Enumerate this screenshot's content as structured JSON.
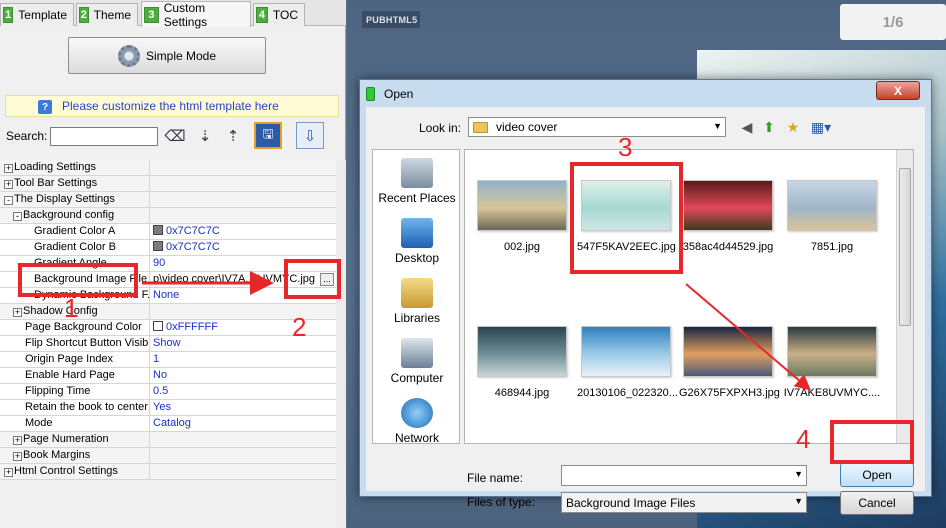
{
  "tabs": [
    {
      "num": "1",
      "label": "Template"
    },
    {
      "num": "2",
      "label": "Theme"
    },
    {
      "num": "3",
      "label": "Custom Settings"
    },
    {
      "num": "4",
      "label": "TOC"
    }
  ],
  "simple_mode_label": "Simple Mode",
  "info_text": "Please customize the html template here",
  "search_label": "Search:",
  "properties": [
    {
      "key": "Loading Settings",
      "value": "",
      "expander": "+",
      "indent": 0
    },
    {
      "key": "Tool Bar Settings",
      "value": "",
      "expander": "+",
      "indent": 0
    },
    {
      "key": "The Display Settings",
      "value": "",
      "expander": "-",
      "indent": 0
    },
    {
      "key": "Background config",
      "value": "",
      "expander": "-",
      "indent": 1
    },
    {
      "key": "Gradient Color A",
      "value": "0x7C7C7C",
      "swatch": "#7c7c7c",
      "indent": 2
    },
    {
      "key": "Gradient Color B",
      "value": "0x7C7C7C",
      "swatch": "#7c7c7c",
      "indent": 2
    },
    {
      "key": "Gradient Angle",
      "value": "90",
      "indent": 2
    },
    {
      "key": "Background Image File",
      "value": "p\\video cover\\IV7A..8UVMYC.jpg",
      "ellipsis": "...",
      "indent": 2
    },
    {
      "key": "Dynamic Background F...",
      "value": "None",
      "indent": 2
    },
    {
      "key": "Shadow Config",
      "value": "",
      "expander": "+",
      "indent": 1
    },
    {
      "key": "Page Background Color",
      "value": "0xFFFFFF",
      "swatch": "#ffffff",
      "indent": 1
    },
    {
      "key": "Flip Shortcut Button Visible",
      "value": "Show",
      "indent": 1
    },
    {
      "key": "Origin Page Index",
      "value": "1",
      "indent": 1
    },
    {
      "key": "Enable Hard Page",
      "value": "No",
      "indent": 1
    },
    {
      "key": "Flipping Time",
      "value": "0.5",
      "indent": 1
    },
    {
      "key": "Retain the book to center",
      "value": "Yes",
      "indent": 1
    },
    {
      "key": "Mode",
      "value": "Catalog",
      "indent": 1
    },
    {
      "key": "Page Numeration",
      "value": "",
      "expander": "+",
      "indent": 1
    },
    {
      "key": "Book Margins",
      "value": "",
      "expander": "+",
      "indent": 1
    },
    {
      "key": "Html Control Settings",
      "value": "",
      "expander": "+",
      "indent": 0
    }
  ],
  "logo_text": "PUBHTML5",
  "pager_text": "1/6",
  "dialog": {
    "title": "Open",
    "look_in_label": "Look in:",
    "look_in_value": "video cover",
    "places": [
      "Recent Places",
      "Desktop",
      "Libraries",
      "Computer",
      "Network"
    ],
    "files": [
      {
        "name": "002.jpg",
        "colors": [
          "#8fb3c9",
          "#d8c59a",
          "#6a6a55"
        ]
      },
      {
        "name": "547F5KAV2EEC.jpg",
        "colors": [
          "#dff0ec",
          "#a4d8d2",
          "#cfe6e4"
        ]
      },
      {
        "name": "358ac4d44529.jpg",
        "colors": [
          "#5a1a1a",
          "#e04a5a",
          "#3a3a1a"
        ]
      },
      {
        "name": "7851.jpg",
        "colors": [
          "#c8d6e4",
          "#9fb6c8",
          "#d9c39a"
        ]
      },
      {
        "name": "468944.jpg",
        "colors": [
          "#2c4450",
          "#6f8f96",
          "#c9d6d8"
        ]
      },
      {
        "name": "20130106_022320...",
        "colors": [
          "#2f7fbf",
          "#9ccbe8",
          "#e8f2f8"
        ]
      },
      {
        "name": "G26X75FXPXH3.jpg",
        "colors": [
          "#1a2540",
          "#e0a060",
          "#4a5a7a"
        ]
      },
      {
        "name": "IV7AKE8UVMYC....",
        "colors": [
          "#2a3a40",
          "#c9b088",
          "#6a7a60"
        ]
      }
    ],
    "file_name_label": "File name:",
    "file_name_value": "",
    "file_type_label": "Files of type:",
    "file_type_value": "Background Image Files",
    "open_label": "Open",
    "cancel_label": "Cancel",
    "close_glyph": "X"
  },
  "annotations": [
    "1",
    "2",
    "3",
    "4"
  ]
}
